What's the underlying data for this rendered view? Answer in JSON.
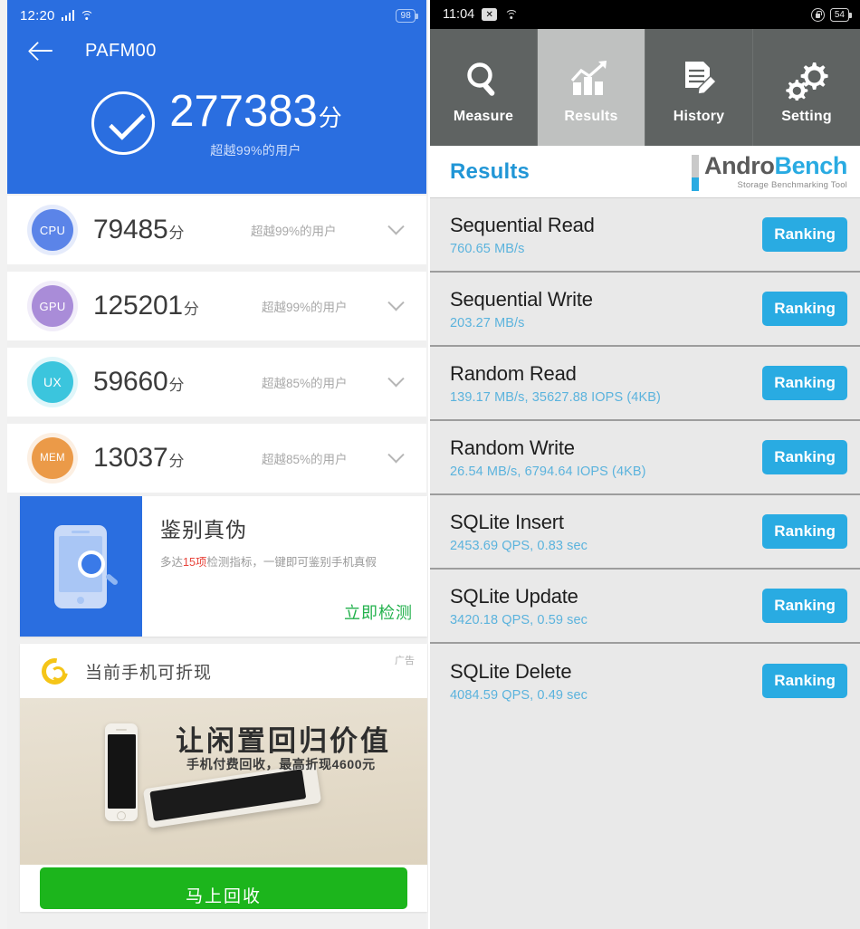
{
  "left": {
    "status": {
      "time": "12:20",
      "battery": "98",
      "signal_icon": "signal-bars-icon",
      "wifi_icon": "wifi-icon"
    },
    "nav": {
      "back_icon": "back-arrow-icon",
      "device_title": "PAFM00"
    },
    "summary": {
      "check_icon": "check-circle-icon",
      "total_score": "277383",
      "unit": "分",
      "percentile": "超越99%的用户"
    },
    "rows": [
      {
        "badge": "CPU",
        "color": "#5b84e8",
        "score": "79485",
        "unit": "分",
        "percentile": "超越99%的用户",
        "chevron": "chevron-down-icon"
      },
      {
        "badge": "GPU",
        "color": "#a98cd8",
        "score": "125201",
        "unit": "分",
        "percentile": "超越99%的用户",
        "chevron": "chevron-down-icon"
      },
      {
        "badge": "UX",
        "color": "#3bc5dd",
        "score": "59660",
        "unit": "分",
        "percentile": "超越85%的用户",
        "chevron": "chevron-down-icon"
      },
      {
        "badge": "MEM",
        "color": "#eb9a48",
        "score": "13037",
        "unit": "分",
        "percentile": "超越85%的用户",
        "chevron": "chevron-down-icon"
      }
    ],
    "promo": {
      "icon": "phone-magnifier-icon",
      "title": "鉴别真伪",
      "desc_pre": "多达",
      "desc_highlight": "15项",
      "desc_post": "检测指标，一键即可鉴别手机真假",
      "cta": "立即检测",
      "cta_color": "#22b14c",
      "highlight_color": "#e8453c"
    },
    "ad": {
      "logo_icon": "recycle-ring-icon",
      "title": "当前手机可折现",
      "tag": "广告",
      "banner_headline": "让闲置回归价值",
      "banner_sub": "手机付费回收，最高折现4600元",
      "button": "马上回收",
      "button_color": "#1cb51c"
    }
  },
  "right": {
    "status": {
      "time": "11:04",
      "mute_icon": "mute-x-icon",
      "wifi_icon": "wifi-icon",
      "lock_icon": "rotation-lock-icon",
      "battery": "54"
    },
    "tabs": [
      {
        "label": "Measure",
        "icon": "magnifier-icon",
        "active": false
      },
      {
        "label": "Results",
        "icon": "bar-chart-icon",
        "active": true
      },
      {
        "label": "History",
        "icon": "document-pen-icon",
        "active": false
      },
      {
        "label": "Setting",
        "icon": "gears-icon",
        "active": false
      }
    ],
    "header": {
      "title": "Results",
      "title_color": "#2196d6",
      "logo_part1": "Andro",
      "logo_part2": "Bench",
      "logo_tagline": "Storage Benchmarking Tool",
      "logo_accent": "#29abe2"
    },
    "ranking_label": "Ranking",
    "benchmarks": [
      {
        "name": "Sequential Read",
        "value": "760.65 MB/s"
      },
      {
        "name": "Sequential Write",
        "value": "203.27 MB/s"
      },
      {
        "name": "Random Read",
        "value": "139.17 MB/s, 35627.88 IOPS (4KB)"
      },
      {
        "name": "Random Write",
        "value": "26.54 MB/s, 6794.64 IOPS (4KB)"
      },
      {
        "name": "SQLite Insert",
        "value": "2453.69 QPS, 0.83 sec"
      },
      {
        "name": "SQLite Update",
        "value": "3420.18 QPS, 0.59 sec"
      },
      {
        "name": "SQLite Delete",
        "value": "4084.59 QPS, 0.49 sec"
      }
    ]
  }
}
